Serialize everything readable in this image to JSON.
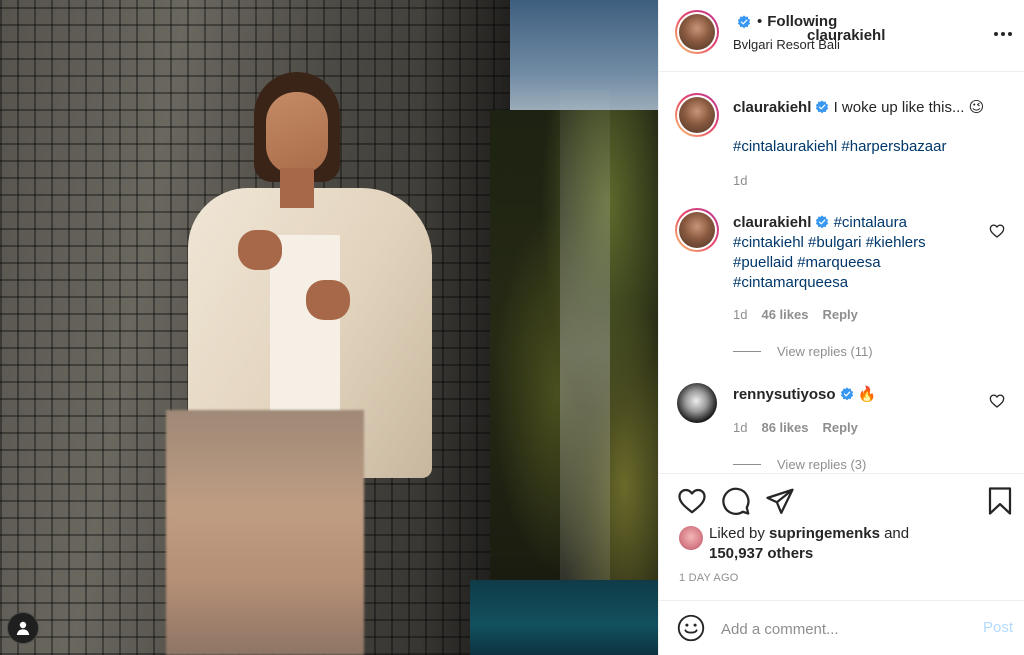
{
  "post": {
    "author": "claurakiehl",
    "follow_status": "Following",
    "separator": "•",
    "location": "Bvlgari Resort Bali"
  },
  "caption": {
    "username": "claurakiehl",
    "text": "I woke up like this... 😉",
    "hashtags": "#cintalaurakiehl #harpersbazaar",
    "time": "1d"
  },
  "comments": [
    {
      "username": "claurakiehl",
      "lines": [
        "#cintalaura",
        "#cintakiehl #bulgari #kiehlers",
        "#puellaid #marqueesa",
        "#cintamarqueesa"
      ],
      "time": "1d",
      "likes": "46 likes",
      "reply": "Reply",
      "view_replies": "View replies (11)"
    },
    {
      "username": "rennysutiyoso",
      "text": "🔥",
      "time": "1d",
      "likes": "86 likes",
      "reply": "Reply",
      "view_replies": "View replies (3)"
    }
  ],
  "likes": {
    "prefix": "Liked by",
    "user": "supringemenks",
    "suffix": "and",
    "others": "150,937 others"
  },
  "timestamp": "1 DAY AGO",
  "comment_box": {
    "placeholder": "Add a comment...",
    "post_label": "Post"
  },
  "colors": {
    "verified": "#3897f0",
    "hashtag": "#00376b",
    "muted": "#8e8e8e",
    "post_disabled": "#b3dbff"
  }
}
